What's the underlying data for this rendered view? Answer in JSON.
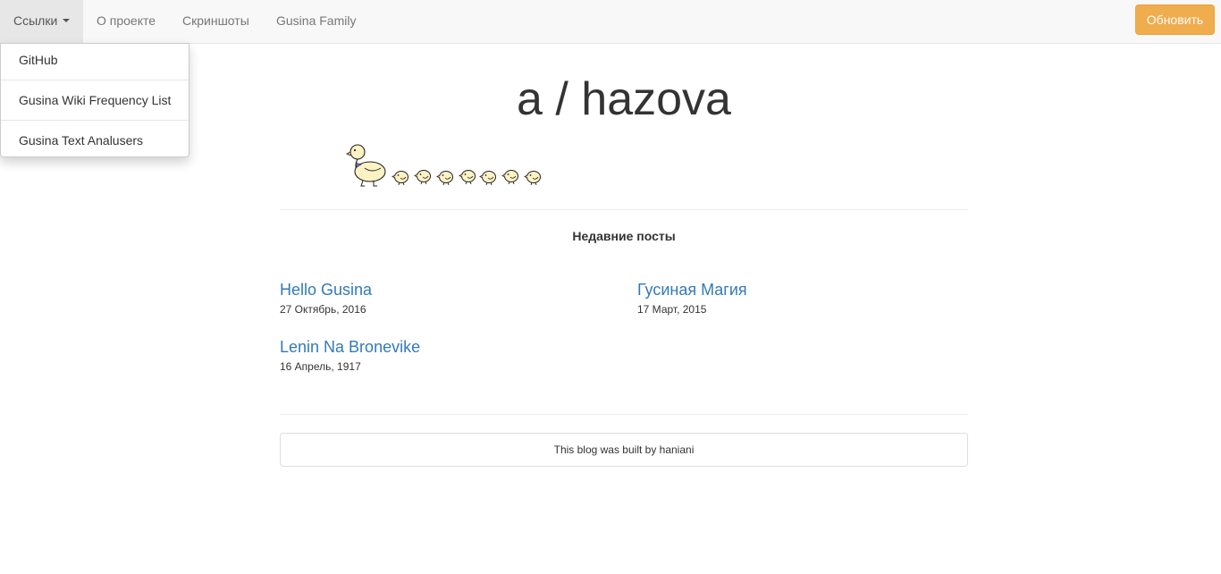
{
  "navbar": {
    "links_label": "Ссылки",
    "about_label": "О проекте",
    "screenshots_label": "Скриншоты",
    "family_label": "Gusina Family",
    "update_button": "Обновить"
  },
  "dropdown": {
    "items": [
      "GitHub",
      "Gusina Wiki Frequency List",
      "Gusina Text Analusers"
    ]
  },
  "header": {
    "title": "a / hazova"
  },
  "recent": {
    "heading": "Недавние посты",
    "posts": [
      {
        "title": "Hello Gusina",
        "date": "27 Октябрь, 2016"
      },
      {
        "title": "Гусиная Магия",
        "date": "17 Март, 2015"
      },
      {
        "title": "Lenin Na Bronevike",
        "date": "16 Апрель, 1917"
      }
    ]
  },
  "footer": {
    "text": "This blog was built by haniani"
  },
  "colors": {
    "accent_link": "#337ab7",
    "button_warning": "#f0ad4e",
    "navbar_bg": "#f8f8f8",
    "duck_fill": "#fdf2c4"
  },
  "icons": [
    "caret-down-icon",
    "goose-icon",
    "gosling-icon"
  ]
}
